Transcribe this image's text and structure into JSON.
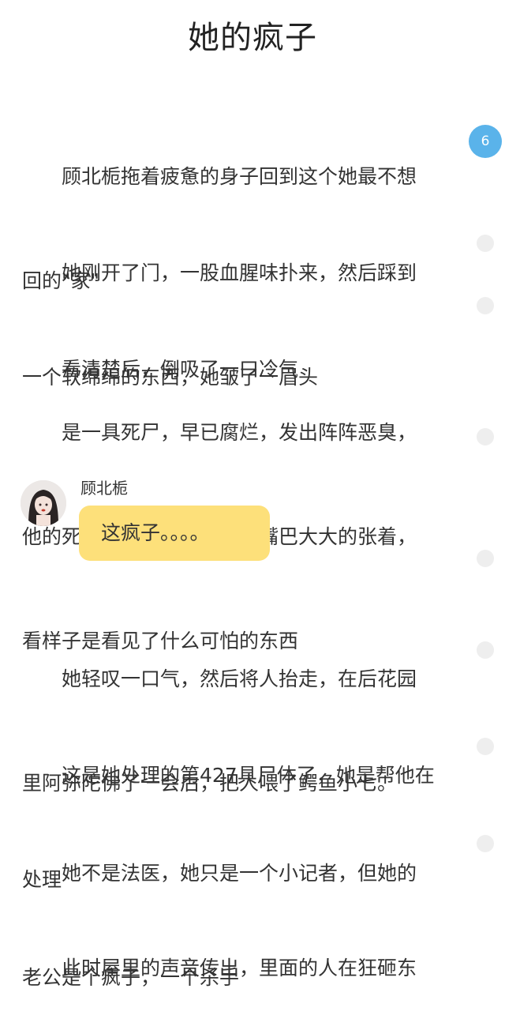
{
  "page_title": "她的疯子",
  "paragraphs": [
    {
      "lines": [
        "　　顾北栀拖着疲惫的身子回到这个她最不想",
        "回的\"家\""
      ]
    },
    {
      "lines": [
        "　　她刚开了门，一股血腥味扑来，然后踩到",
        "一个软绵绵的东西，她皱了一眉头"
      ]
    },
    {
      "lines": [
        "　　看清楚后，倒吸了一口冷气"
      ]
    },
    {
      "lines": [
        "　　是一具死尸，早已腐烂，发出阵阵恶臭，",
        "他的死相很惨，双眼挖出，嘴巴大大的张着，",
        "看样子是看见了什么可怕的东西"
      ]
    },
    {
      "lines": [
        "　　她轻叹一口气，然后将人抬走，在后花园",
        "里阿弥陀佛了一会后，把人喂了鳄鱼小七。"
      ]
    },
    {
      "lines": [
        "　　这是她处理的第427具尸体了，她是帮他在",
        "处理"
      ]
    },
    {
      "lines": [
        "　　她不是法医，她只是一个小记者，但她的",
        "老公是个疯子，一个杀手"
      ]
    },
    {
      "lines": [
        "　　此时屋里的声音传出，里面的人在狂砸东"
      ]
    }
  ],
  "chat": {
    "sender_name": "顾北栀",
    "message": "这疯子。。。。"
  },
  "comment_markers": [
    {
      "count": "6",
      "active": true
    }
  ],
  "colors": {
    "accent_blue": "#5ab3ea",
    "bubble_yellow": "#fde07a",
    "marker_gray": "#eeeeee"
  }
}
